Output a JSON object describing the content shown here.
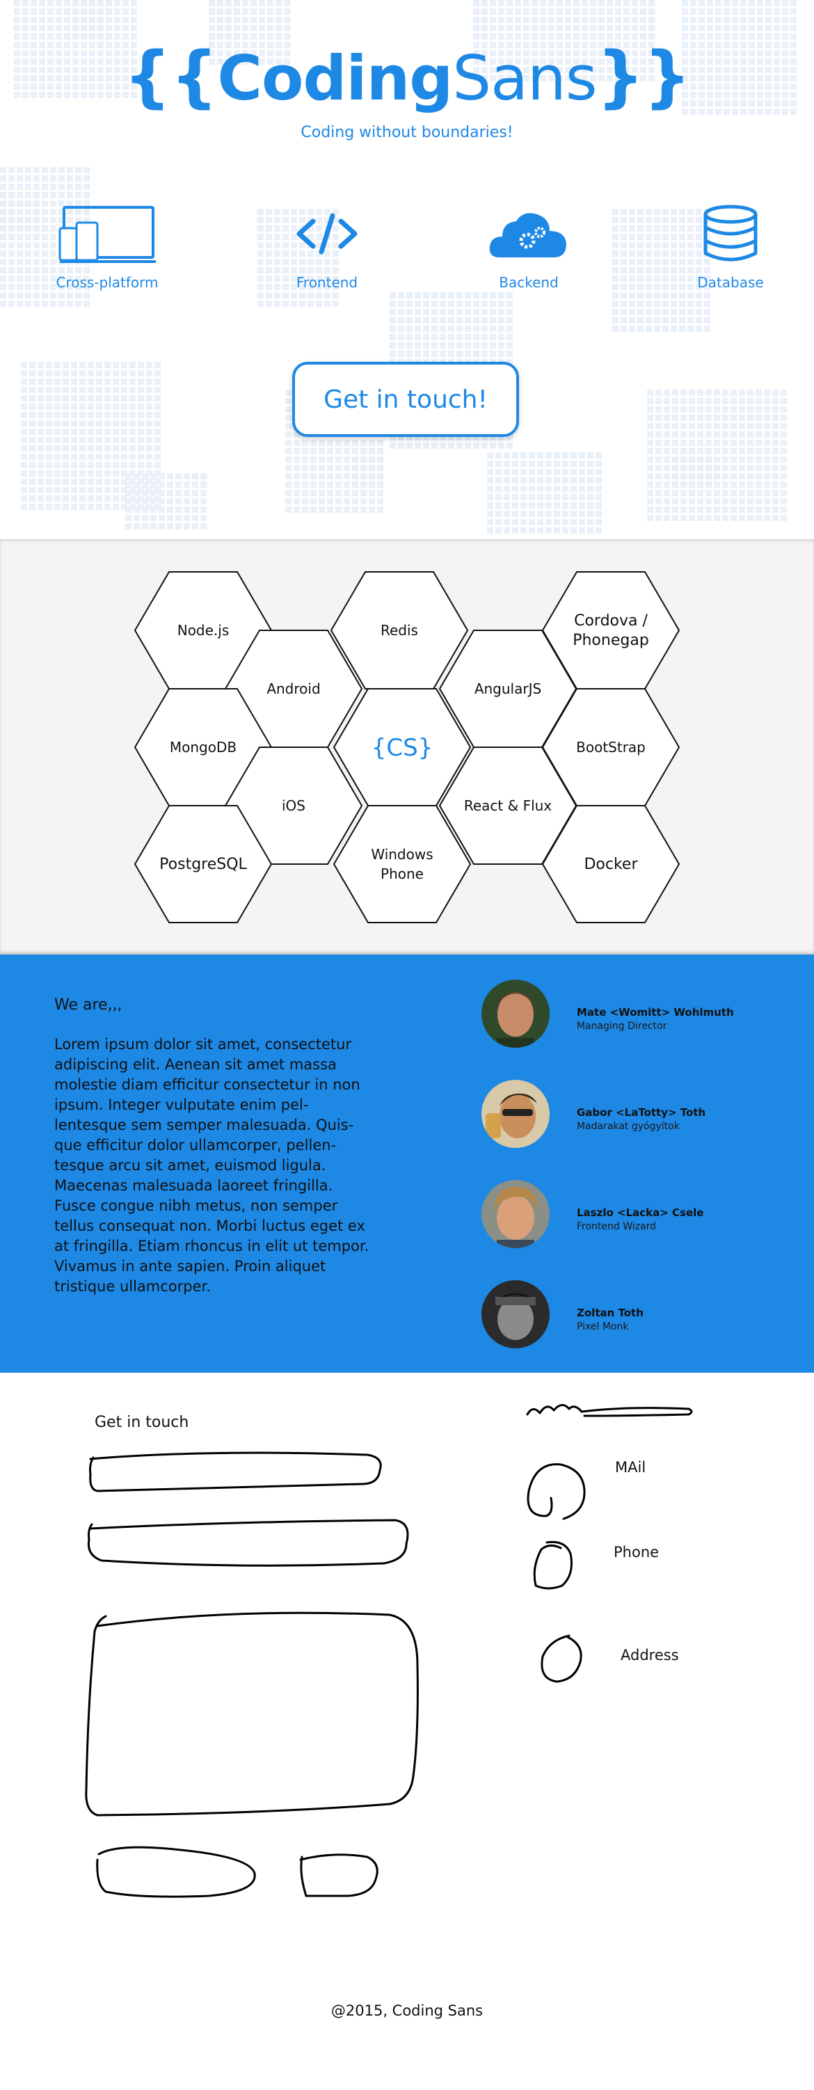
{
  "header": {
    "logo_open": "{{",
    "logo_word1": "Coding",
    "logo_word2": "Sans",
    "logo_close": "}}",
    "tagline": "Coding without boundaries!"
  },
  "features": [
    {
      "label": "Cross-platform",
      "icon": "devices-icon"
    },
    {
      "label": "Frontend",
      "icon": "code-icon"
    },
    {
      "label": "Backend",
      "icon": "cloud-gears-icon"
    },
    {
      "label": "Database",
      "icon": "database-icon"
    }
  ],
  "cta_label": "Get in touch!",
  "technologies": {
    "center_logo": "{CS}",
    "items": [
      "Node.js",
      "Redis",
      "Cordova /",
      "Phonegap",
      "Android",
      "AngularJS",
      "MongoDB",
      "BootStrap",
      "iOS",
      "React & Flux",
      "PostgreSQL",
      "Windows",
      "Phone",
      "Docker"
    ]
  },
  "team": {
    "intro": "We are,,,",
    "description": "Lorem ipsum dolor sit amet, consectetur adipiscing elit. Aenean sit amet massa molestie diam efficitur consectetur in non ipsum. Integer vulputate enim pel-lentesque sem semper malesuada. Quis-que efficitur dolor ullamcorper, pellen-tesque arcu sit amet, euismod ligula. Maecenas malesuada laoreet fringilla. Fusce congue nibh metus, non semper tellus consequat non. Morbi luctus eget ex at fringilla. Etiam rhoncus in elit ut tempor. Vivamus in ante sapien. Proin aliquet tristique ullamcorper.",
    "members": [
      {
        "name": "Mate <Womitt> Wohlmuth",
        "role": "Managing Director"
      },
      {
        "name": "Gabor <LaTotty> Toth",
        "role": "Madarakat gyógyítok"
      },
      {
        "name": "Laszlo <Lacka> Csele",
        "role": "Frontend Wizard"
      },
      {
        "name": "Zoltan Toth",
        "role": "Pixel Monk"
      }
    ]
  },
  "contact": {
    "title": "Get in touch",
    "mail_label": "MAil",
    "phone_label": "Phone",
    "address_label": "Address"
  },
  "footer": "@2015, Coding Sans",
  "colors": {
    "brand": "#1e88e5",
    "section_gray": "#f4f4f4"
  }
}
